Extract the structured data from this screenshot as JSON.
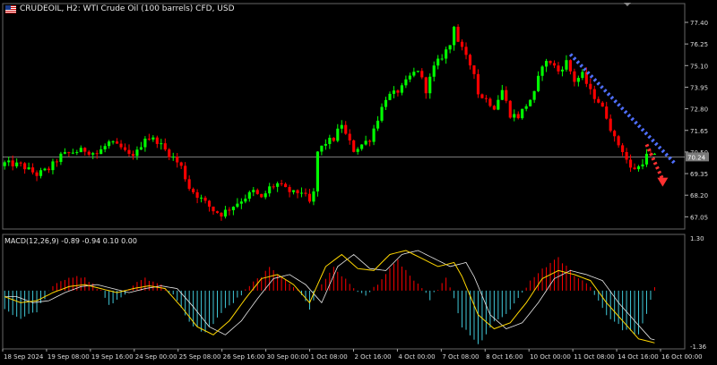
{
  "header": {
    "title": "CRUDEOIL, H2:  WTI Crude Oil (100 barrels) CFD, USD"
  },
  "indicator": {
    "label": "MACD(12,26,9) -0.89 -0.94 0.10 0.00"
  },
  "colors": {
    "background": "#000000",
    "bull": "#00ff00",
    "bear": "#ff0000",
    "grid": "#ffffff",
    "price_line": "#c0c0c0",
    "macd_pos": "#ff0000",
    "macd_neg": "#40c8d8",
    "macd_signal": "#ffd700",
    "trendline": "#4f6fff",
    "forecast_arrow": "#ff3030"
  },
  "chart_data": {
    "type": "candlestick",
    "symbol": "CRUDEOIL",
    "timeframe": "H2",
    "current_price": "70.24",
    "y_ticks": [
      "77.40",
      "76.25",
      "75.10",
      "73.95",
      "72.80",
      "71.65",
      "70.50",
      "69.35",
      "68.20",
      "67.05"
    ],
    "ylim": [
      66.4,
      78.4
    ],
    "x_ticks": [
      "18 Sep 2024",
      "19 Sep 08:00",
      "19 Sep 16:00",
      "24 Sep 00:00",
      "25 Sep 08:00",
      "26 Sep 16:00",
      "30 Sep 00:00",
      "1 Oct 08:00",
      "2 Oct 16:00",
      "4 Oct 00:00",
      "7 Oct 08:00",
      "8 Oct 16:00",
      "10 Oct 00:00",
      "11 Oct 08:00",
      "14 Oct 16:00",
      "16 Oct 00:00"
    ],
    "close_path": [
      [
        0,
        69.9
      ],
      [
        4,
        69.8
      ],
      [
        8,
        69.3
      ],
      [
        11,
        69.6
      ],
      [
        14,
        70.3
      ],
      [
        17,
        70.5
      ],
      [
        20,
        70.6
      ],
      [
        23,
        70.4
      ],
      [
        26,
        71.0
      ],
      [
        29,
        70.7
      ],
      [
        31,
        70.3
      ],
      [
        33,
        70.5
      ],
      [
        35,
        71.3
      ],
      [
        38,
        71.1
      ],
      [
        40,
        70.6
      ],
      [
        42,
        70.2
      ],
      [
        44,
        69.7
      ],
      [
        46,
        68.6
      ],
      [
        48,
        68.2
      ],
      [
        50,
        67.8
      ],
      [
        52,
        67.4
      ],
      [
        54,
        67.2
      ],
      [
        56,
        67.5
      ],
      [
        58,
        67.8
      ],
      [
        60,
        68.1
      ],
      [
        62,
        68.4
      ],
      [
        64,
        68.0
      ],
      [
        66,
        68.6
      ],
      [
        68,
        68.8
      ],
      [
        70,
        68.5
      ],
      [
        72,
        68.3
      ],
      [
        74,
        68.4
      ],
      [
        76,
        67.8
      ],
      [
        77,
        68.3
      ],
      [
        78,
        70.5
      ],
      [
        80,
        71.0
      ],
      [
        82,
        71.2
      ],
      [
        84,
        72.0
      ],
      [
        85,
        71.4
      ],
      [
        87,
        70.6
      ],
      [
        89,
        70.9
      ],
      [
        91,
        71.2
      ],
      [
        93,
        72.3
      ],
      [
        95,
        73.4
      ],
      [
        97,
        73.6
      ],
      [
        99,
        73.9
      ],
      [
        101,
        74.5
      ],
      [
        103,
        74.9
      ],
      [
        105,
        73.8
      ],
      [
        107,
        75.0
      ],
      [
        109,
        75.6
      ],
      [
        111,
        76.2
      ],
      [
        112,
        77.3
      ],
      [
        113,
        76.4
      ],
      [
        115,
        75.5
      ],
      [
        117,
        74.8
      ],
      [
        118,
        73.6
      ],
      [
        120,
        73.3
      ],
      [
        122,
        72.9
      ],
      [
        124,
        73.8
      ],
      [
        126,
        72.5
      ],
      [
        128,
        72.4
      ],
      [
        130,
        73.0
      ],
      [
        132,
        73.6
      ],
      [
        134,
        75.2
      ],
      [
        136,
        75.3
      ],
      [
        138,
        74.8
      ],
      [
        140,
        75.3
      ],
      [
        142,
        74.3
      ],
      [
        144,
        74.6
      ],
      [
        146,
        73.7
      ],
      [
        148,
        73.2
      ],
      [
        150,
        72.4
      ],
      [
        152,
        71.2
      ],
      [
        154,
        70.6
      ],
      [
        156,
        69.6
      ],
      [
        158,
        69.7
      ],
      [
        160,
        70.3
      ],
      [
        162,
        70.25
      ]
    ],
    "macd_hist": [
      [
        0,
        -0.45
      ],
      [
        4,
        -0.7
      ],
      [
        8,
        -0.5
      ],
      [
        12,
        0.15
      ],
      [
        16,
        0.35
      ],
      [
        20,
        0.3
      ],
      [
        24,
        0.0
      ],
      [
        26,
        -0.35
      ],
      [
        29,
        -0.2
      ],
      [
        32,
        0.15
      ],
      [
        35,
        0.32
      ],
      [
        38,
        0.2
      ],
      [
        42,
        -0.1
      ],
      [
        46,
        -0.8
      ],
      [
        50,
        -1.05
      ],
      [
        54,
        -0.55
      ],
      [
        58,
        -0.2
      ],
      [
        62,
        0.2
      ],
      [
        66,
        0.55
      ],
      [
        70,
        0.3
      ],
      [
        74,
        -0.1
      ],
      [
        76,
        -0.45
      ],
      [
        78,
        0.0
      ],
      [
        82,
        0.6
      ],
      [
        86,
        0.15
      ],
      [
        90,
        -0.15
      ],
      [
        94,
        0.3
      ],
      [
        98,
        0.75
      ],
      [
        102,
        0.25
      ],
      [
        106,
        -0.2
      ],
      [
        110,
        0.3
      ],
      [
        112,
        -0.2
      ],
      [
        114,
        -0.9
      ],
      [
        118,
        -1.35
      ],
      [
        122,
        -0.8
      ],
      [
        126,
        -0.5
      ],
      [
        130,
        0.1
      ],
      [
        134,
        0.55
      ],
      [
        138,
        0.8
      ],
      [
        142,
        0.4
      ],
      [
        146,
        0.1
      ],
      [
        150,
        -0.6
      ],
      [
        154,
        -0.95
      ],
      [
        158,
        -1.1
      ],
      [
        160,
        -0.6
      ],
      [
        162,
        0.1
      ]
    ],
    "macd_signal": [
      [
        0,
        -0.15
      ],
      [
        4,
        -0.3
      ],
      [
        8,
        -0.25
      ],
      [
        12,
        -0.05
      ],
      [
        16,
        0.1
      ],
      [
        20,
        0.15
      ],
      [
        24,
        0.05
      ],
      [
        28,
        -0.05
      ],
      [
        32,
        0.05
      ],
      [
        36,
        0.12
      ],
      [
        40,
        0.05
      ],
      [
        44,
        -0.4
      ],
      [
        48,
        -0.9
      ],
      [
        52,
        -1.1
      ],
      [
        56,
        -0.75
      ],
      [
        60,
        -0.2
      ],
      [
        64,
        0.3
      ],
      [
        68,
        0.4
      ],
      [
        72,
        0.15
      ],
      [
        76,
        -0.3
      ],
      [
        80,
        0.6
      ],
      [
        84,
        0.9
      ],
      [
        88,
        0.55
      ],
      [
        92,
        0.5
      ],
      [
        96,
        0.9
      ],
      [
        100,
        1.0
      ],
      [
        104,
        0.8
      ],
      [
        108,
        0.6
      ],
      [
        112,
        0.7
      ],
      [
        114,
        0.35
      ],
      [
        118,
        -0.6
      ],
      [
        122,
        -0.95
      ],
      [
        126,
        -0.8
      ],
      [
        130,
        -0.3
      ],
      [
        134,
        0.3
      ],
      [
        138,
        0.5
      ],
      [
        142,
        0.4
      ],
      [
        146,
        0.25
      ],
      [
        150,
        -0.3
      ],
      [
        154,
        -0.75
      ],
      [
        158,
        -1.2
      ],
      [
        162,
        -1.3
      ]
    ],
    "macd_ticks": [
      "1.30",
      "-1.36"
    ],
    "macd_ylim": [
      -1.45,
      1.4
    ],
    "annotations": [
      {
        "type": "trendline",
        "style": "dotted",
        "from": [
          141,
          75.7
        ],
        "to": [
          167,
          69.9
        ]
      },
      {
        "type": "arrow",
        "style": "dotted",
        "from": [
          160,
          70.9
        ],
        "to": [
          164,
          68.8
        ]
      }
    ]
  }
}
